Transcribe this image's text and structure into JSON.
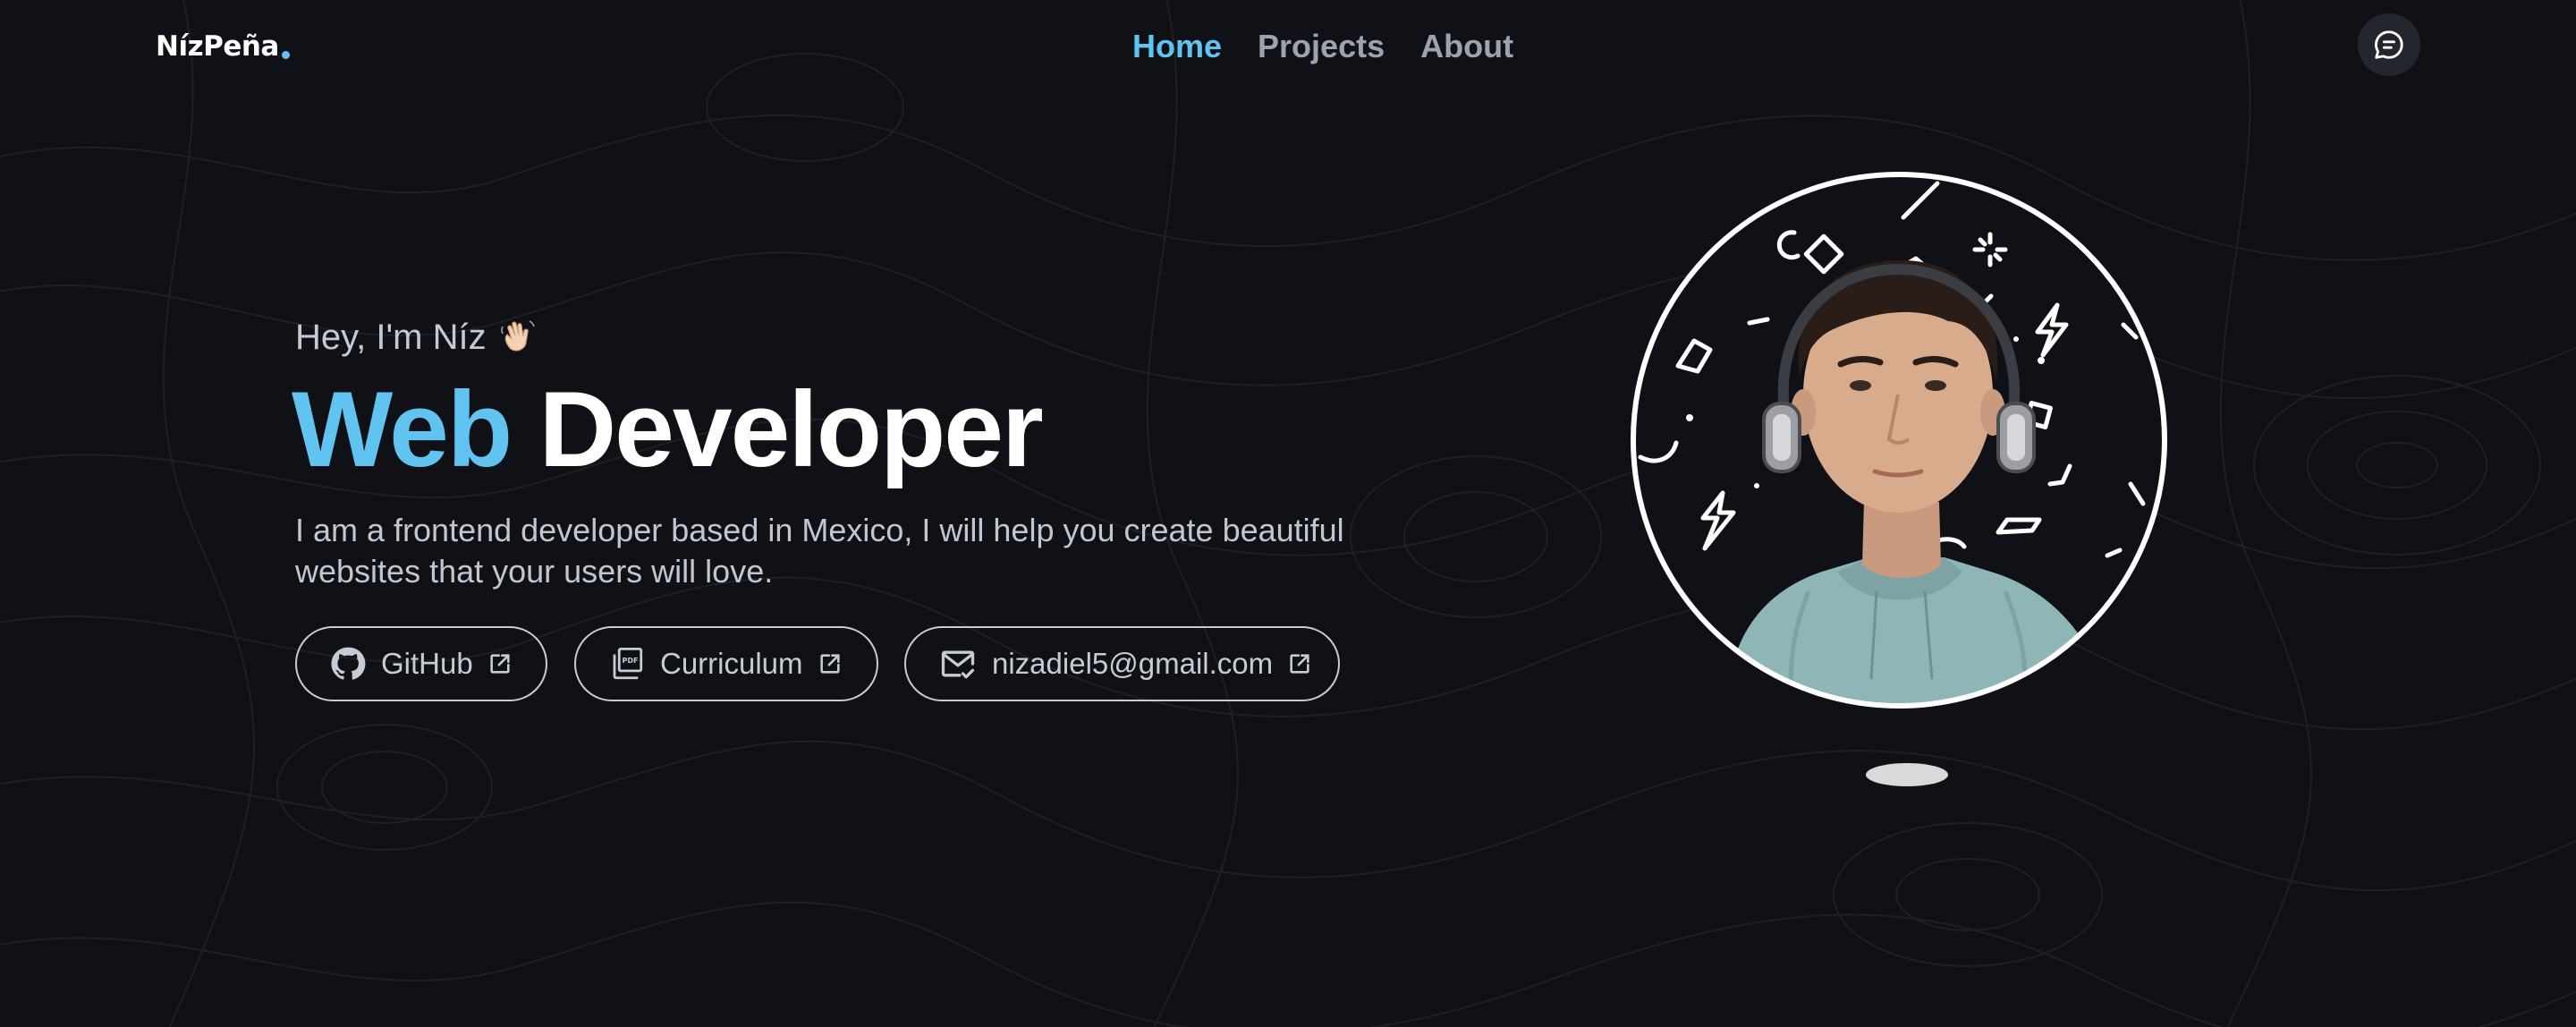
{
  "header": {
    "logo": "NízPeña",
    "nav": [
      {
        "label": "Home",
        "active": true
      },
      {
        "label": "Projects",
        "active": false
      },
      {
        "label": "About",
        "active": false
      }
    ],
    "chat_icon": "chat-bubble-icon"
  },
  "hero": {
    "greeting": "Hey, I'm Níz",
    "greeting_emoji": "waving-hand-icon",
    "title_accent": "Web",
    "title_main": "Developer",
    "description": "I am a frontend developer based in Mexico, I will help you create beautiful websites that your users will love.",
    "buttons": [
      {
        "label": "GitHub",
        "icon": "github-icon",
        "trailing_icon": "external-link-icon"
      },
      {
        "label": "Curriculum",
        "icon": "pdf-icon",
        "trailing_icon": "external-link-icon"
      },
      {
        "label": "nizadiel5@gmail.com",
        "icon": "mail-check-icon",
        "trailing_icon": "external-link-icon"
      }
    ]
  },
  "colors": {
    "background": "#0f1116",
    "accent": "#61c3f0",
    "text_muted": "#9ca3ae",
    "button_border": "#c7ccd3"
  }
}
